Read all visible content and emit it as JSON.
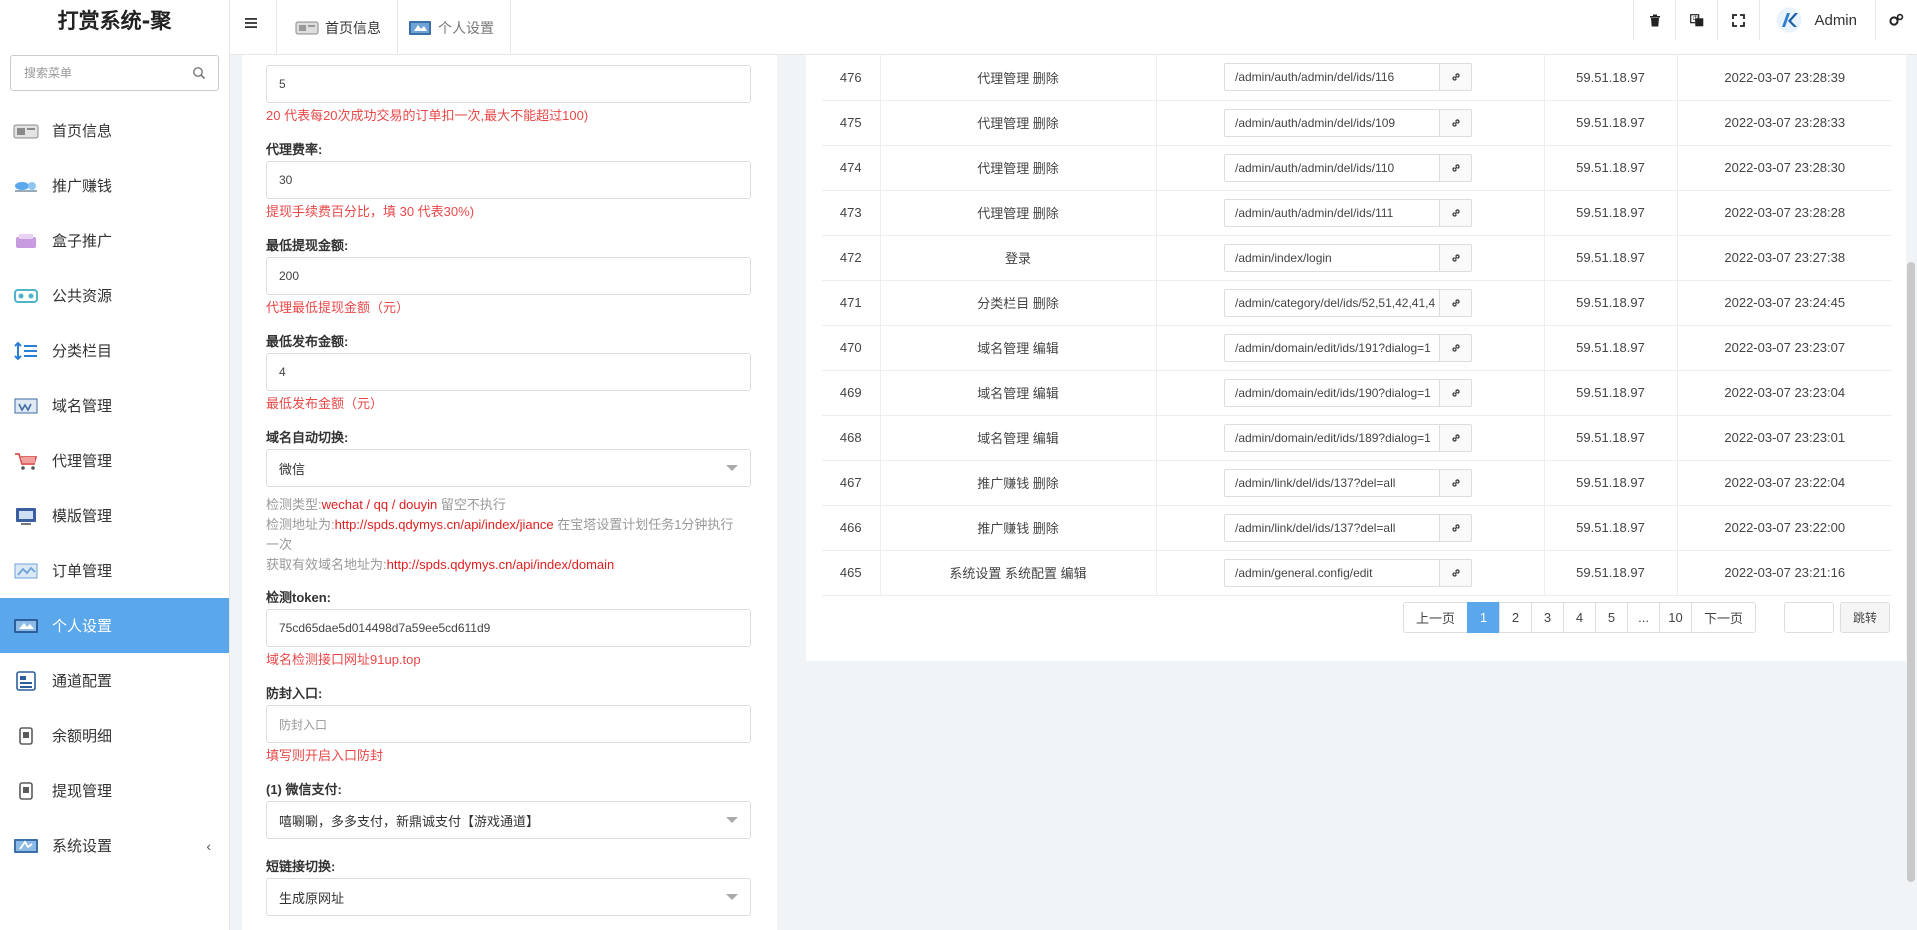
{
  "app": {
    "brand": "打赏系统-聚"
  },
  "sidebar": {
    "search_placeholder": "搜索菜单",
    "items": [
      {
        "label": "首页信息",
        "icon": "home-icon",
        "color": "#8a8a8a"
      },
      {
        "label": "推广赚钱",
        "icon": "promo-icon",
        "color": "#5ba7ec"
      },
      {
        "label": "盒子推广",
        "icon": "box-icon",
        "color": "#c89adf"
      },
      {
        "label": "公共资源",
        "icon": "resource-icon",
        "color": "#4fb3c9"
      },
      {
        "label": "分类栏目",
        "icon": "category-icon",
        "color": "#2a7fd4"
      },
      {
        "label": "域名管理",
        "icon": "domain-icon",
        "color": "#3d6ea8"
      },
      {
        "label": "代理管理",
        "icon": "agent-cart-icon",
        "color": "#d9534f"
      },
      {
        "label": "模版管理",
        "icon": "template-icon",
        "color": "#3b5ea0"
      },
      {
        "label": "订单管理",
        "icon": "order-icon",
        "color": "#6fa3d8"
      },
      {
        "label": "个人设置",
        "icon": "profile-card-icon",
        "color": "#3c6fa8"
      },
      {
        "label": "通道配置",
        "icon": "channel-icon",
        "color": "#2e5e9c"
      },
      {
        "label": "余额明细",
        "icon": "balance-icon",
        "color": "#5c5c5c"
      },
      {
        "label": "提现管理",
        "icon": "withdraw-icon",
        "color": "#5c5c5c"
      },
      {
        "label": "系统设置",
        "icon": "system-icon",
        "color": "#3c6fa8"
      }
    ],
    "active_index": 9,
    "active_color": "#5ba7ec"
  },
  "topbar": {
    "tabs": [
      {
        "label": "首页信息"
      },
      {
        "label": "个人设置"
      }
    ],
    "user": "Admin"
  },
  "form": {
    "f1": {
      "value": "5",
      "hint": "20 代表每20次成功交易的订单扣一次,最大不能超过100)"
    },
    "f2": {
      "label": "代理费率:",
      "value": "30",
      "hint": "提现手续费百分比，填 30 代表30%)"
    },
    "f3": {
      "label": "最低提现金额:",
      "value": "200",
      "hint": "代理最低提现金额（元）"
    },
    "f4": {
      "label": "最低发布金额:",
      "value": "4",
      "hint": "最低发布金额（元）"
    },
    "f5": {
      "label": "域名自动切换:",
      "value": "微信",
      "hint1_prefix": "检测类型:",
      "hint1_red": "wechat / qq / douyin",
      "hint1_suffix": " 留空不执行",
      "hint2_prefix": "检测地址为:",
      "hint2_red": "http://spds.qdymys.cn/api/index/jiance",
      "hint2_suffix": " 在宝塔设置计划任务1分钟执行一次",
      "hint3_prefix": "获取有效域名地址为:",
      "hint3_red": "http://spds.qdymys.cn/api/index/domain"
    },
    "f6": {
      "label": "检测token:",
      "value": "75cd65dae5d014498d7a59ee5cd611d9",
      "hint": "域名检测接口网址91up.top"
    },
    "f7": {
      "label": "防封入口:",
      "placeholder": "防封入口",
      "hint": "填写则开启入口防封"
    },
    "f8": {
      "label": "(1) 微信支付:",
      "value": "嘻唰唰，多多支付，新鼎诚支付【游戏通道】"
    },
    "f9": {
      "label": "短链接切换:",
      "value": "生成原网址"
    }
  },
  "log": {
    "rows": [
      {
        "id": "476",
        "title": "代理管理 删除",
        "url": "/admin/auth/admin/del/ids/116",
        "ip": "59.51.18.97",
        "time": "2022-03-07 23:28:39"
      },
      {
        "id": "475",
        "title": "代理管理 删除",
        "url": "/admin/auth/admin/del/ids/109",
        "ip": "59.51.18.97",
        "time": "2022-03-07 23:28:33"
      },
      {
        "id": "474",
        "title": "代理管理 删除",
        "url": "/admin/auth/admin/del/ids/110",
        "ip": "59.51.18.97",
        "time": "2022-03-07 23:28:30"
      },
      {
        "id": "473",
        "title": "代理管理 删除",
        "url": "/admin/auth/admin/del/ids/111",
        "ip": "59.51.18.97",
        "time": "2022-03-07 23:28:28"
      },
      {
        "id": "472",
        "title": "登录",
        "url": "/admin/index/login",
        "ip": "59.51.18.97",
        "time": "2022-03-07 23:27:38"
      },
      {
        "id": "471",
        "title": "分类栏目 删除",
        "url": "/admin/category/del/ids/52,51,42,41,4",
        "ip": "59.51.18.97",
        "time": "2022-03-07 23:24:45"
      },
      {
        "id": "470",
        "title": "域名管理 编辑",
        "url": "/admin/domain/edit/ids/191?dialog=1",
        "ip": "59.51.18.97",
        "time": "2022-03-07 23:23:07"
      },
      {
        "id": "469",
        "title": "域名管理 编辑",
        "url": "/admin/domain/edit/ids/190?dialog=1",
        "ip": "59.51.18.97",
        "time": "2022-03-07 23:23:04"
      },
      {
        "id": "468",
        "title": "域名管理 编辑",
        "url": "/admin/domain/edit/ids/189?dialog=1",
        "ip": "59.51.18.97",
        "time": "2022-03-07 23:23:01"
      },
      {
        "id": "467",
        "title": "推广赚钱 删除",
        "url": "/admin/link/del/ids/137?del=all",
        "ip": "59.51.18.97",
        "time": "2022-03-07 23:22:04"
      },
      {
        "id": "466",
        "title": "推广赚钱 删除",
        "url": "/admin/link/del/ids/137?del=all",
        "ip": "59.51.18.97",
        "time": "2022-03-07 23:22:00"
      },
      {
        "id": "465",
        "title": "系统设置 系统配置 编辑",
        "url": "/admin/general.config/edit",
        "ip": "59.51.18.97",
        "time": "2022-03-07 23:21:16"
      }
    ]
  },
  "pagination": {
    "prev": "上一页",
    "pages": [
      "1",
      "2",
      "3",
      "4",
      "5",
      "...",
      "10"
    ],
    "current": "1",
    "next": "下一页",
    "jump": "跳转"
  }
}
